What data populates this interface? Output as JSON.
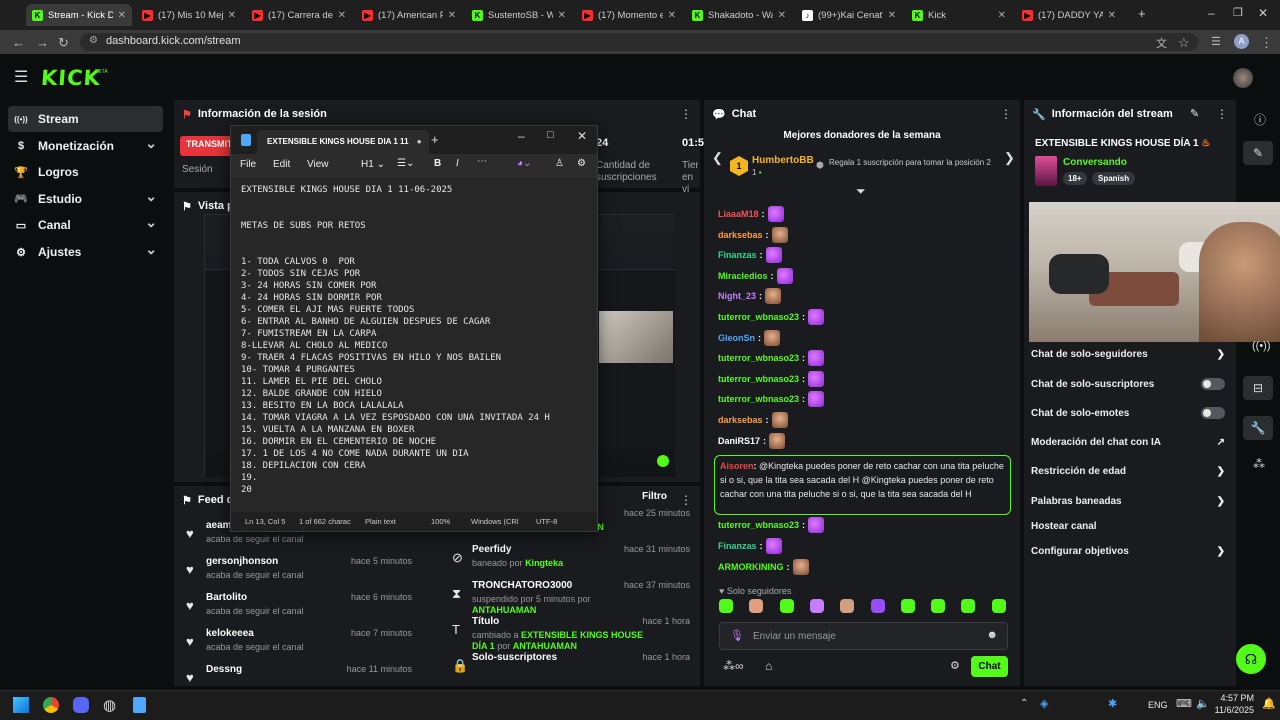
{
  "browser": {
    "tabs": [
      {
        "label": "Stream - Kick Dash",
        "favicon": "kick",
        "active": true
      },
      {
        "label": "(17) Mis 10 Mejore",
        "favicon": "youtube"
      },
      {
        "label": "(17) Carrera de gu",
        "favicon": "youtube"
      },
      {
        "label": "(17) American Pie",
        "favicon": "youtube"
      },
      {
        "label": "SustentoSB - Watc",
        "favicon": "kick"
      },
      {
        "label": "(17) Momento exa",
        "favicon": "youtube"
      },
      {
        "label": "Shakadoto - Watc",
        "favicon": "kick"
      },
      {
        "label": "(99+)Kai Cenat's l",
        "favicon": "tiktok"
      },
      {
        "label": "Kick",
        "favicon": "kick"
      },
      {
        "label": "(17) DADDY YANK",
        "favicon": "youtube"
      }
    ],
    "url": "dashboard.kick.com/stream",
    "profile_initial": "A"
  },
  "header": {
    "logo": "KICK",
    "beta": "BETA"
  },
  "sidebar": {
    "items": [
      {
        "label": "Stream",
        "icon": "broadcast-icon",
        "selected": true
      },
      {
        "label": "Monetización",
        "icon": "dollar-icon",
        "chevron": true
      },
      {
        "label": "Logros",
        "icon": "trophy-icon"
      },
      {
        "label": "Estudio",
        "icon": "gamepad-icon",
        "chevron": true
      },
      {
        "label": "Canal",
        "icon": "monitor-icon",
        "chevron": true
      },
      {
        "label": "Ajustes",
        "icon": "gear-icon",
        "chevron": true
      }
    ]
  },
  "session": {
    "title": "Información de la sesión",
    "live_badge": "TRANSMIT",
    "session_label": "Sesión",
    "stat_24": "24",
    "stat_24_label": "Cantidad de suscripciones",
    "stat_time": "01:5",
    "stat_time_label": "Tiem en vi"
  },
  "preview": {
    "title": "Vista pr"
  },
  "feed": {
    "title": "Feed de",
    "filter": "Filtro",
    "left": [
      {
        "name": "aeam",
        "desc": "acaba de seguir el canal",
        "time": ""
      },
      {
        "name": "gersonjhonson",
        "desc": "acaba de seguir el canal",
        "time": "hace 5 minutos"
      },
      {
        "name": "Bartolito",
        "desc": "acaba de seguir el canal",
        "time": "hace 6 minutos"
      },
      {
        "name": "kelokeeea",
        "desc": "acaba de seguir el canal",
        "time": "hace 7 minutos"
      },
      {
        "name": "Dessng",
        "desc": "",
        "time": "hace 11 minutos"
      }
    ],
    "right": [
      {
        "name": "",
        "desc": "desbaneado por",
        "by": "ANTAHUAMAN",
        "time": "hace 25 minutos"
      },
      {
        "name": "Peerfidy",
        "desc": "baneado por",
        "by": "Kingteka",
        "time": "hace 31 minutos"
      },
      {
        "name": "TRONCHATORO3000",
        "desc": "suspendido por 5 minutos por",
        "by": "ANTAHUAMAN",
        "time": "hace 37 minutos"
      },
      {
        "name": "Título",
        "desc": "cambiado a",
        "by": "EXTENSIBLE KINGS HOUSE DÍA 1",
        "by2": "por",
        "by3": "ANTAHUAMAN",
        "time": "hace 1 hora"
      },
      {
        "name": "Solo-suscriptores",
        "desc": "",
        "time": "hace 1 hora"
      }
    ]
  },
  "notepad": {
    "tab_title": "EXTENSIBLE KINGS HOUSE DIA 1 11",
    "menu": [
      "File",
      "Edit",
      "View"
    ],
    "heading": "H1",
    "content": "EXTENSIBLE KINGS HOUSE DIA 1 11-06-2025\n\n\nMETAS DE SUBS POR RETOS\n\n\n1- TODA CALVOS 0  POR\n2- TODOS SIN CEJAS POR\n3- 24 HORAS SIN COMER POR\n4- 24 HORAS SIN DORMIR POR\n5- COMER EL AJI MAS FUERTE TODOS\n6- ENTRAR AL BANHO DE ALGUIEN DESPUES DE CAGAR\n7- FUMISTREAM EN LA CARPA\n8-LLEVAR AL CHOLO AL MEDICO\n9- TRAER 4 FLACAS POSITIVAS EN HILO Y NOS BAILEN\n10- TOMAR 4 PURGANTES\n11. LAMER EL PIE DEL CHOLO\n12. BALDE GRANDE CON HIELO\n13. BESITO EN LA BOCA LALALALA\n14. TOMAR VIAGRA A LA VEZ ESPOSDADO CON UNA INVITADA 24 H\n15. VUELTA A LA MANZANA EN BOXER\n16. DORMIR EN EL CEMENTERIO DE NOCHE\n17. 1 DE LOS 4 NO COME NADA DURANTE UN DIA\n18. DEPILACION CON CERA\n19.\n20",
    "status": {
      "pos": "Ln 13, Col 5",
      "chars": "1 of 662 charac",
      "type": "Plain text",
      "zoom": "100%",
      "eol": "Windows (CRl",
      "enc": "UTF-8"
    }
  },
  "chat": {
    "title": "Chat",
    "donors_title": "Mejores donadores de la semana",
    "top_donor": "HumbertoBB",
    "top_donor_rank": "1",
    "top_donor_count": "1",
    "second_text": "Regala 1 suscripción para tomar la posición 2",
    "messages": [
      {
        "user": "LiaaaM18",
        "color": "#ff4f4f",
        "emote": "purple"
      },
      {
        "user": "darksebas",
        "color": "#ff9f3a",
        "emote": "face"
      },
      {
        "user": "Finanzas",
        "color": "#2fd68e",
        "emote": "purple"
      },
      {
        "user": "Miracledios",
        "color": "#53fc18",
        "emote": "purple"
      },
      {
        "user": "Night_23",
        "color": "#c77dff",
        "emote": "face"
      },
      {
        "user": "tuterror_wbnaso23",
        "color": "#53fc18",
        "emote": "purple"
      },
      {
        "user": "GleonSn",
        "color": "#4ea8ff",
        "emote": "face"
      },
      {
        "user": "tuterror_wbnaso23",
        "color": "#53fc18",
        "emote": "purple"
      },
      {
        "user": "tuterror_wbnaso23",
        "color": "#53fc18",
        "emote": "purple"
      },
      {
        "user": "tuterror_wbnaso23",
        "color": "#53fc18",
        "emote": "purple"
      },
      {
        "user": "darksebas",
        "color": "#ff9f3a",
        "emote": "face"
      },
      {
        "user": "DaniRS17",
        "color": "#ffffff",
        "emote": "face"
      }
    ],
    "highlight": {
      "user": "Aisoren",
      "text": "@Kingteka puedes poner de reto cachar con una tita peluche si o si, que la tita sea sacada del H  @Kingteka puedes poner de reto cachar con una tita peluche si o si, que la tita sea sacada del H"
    },
    "after": [
      {
        "user": "tuterror_wbnaso23",
        "color": "#53fc18",
        "emote": "purple"
      },
      {
        "user": "Finanzas",
        "color": "#2fd68e",
        "emote": "purple"
      },
      {
        "user": "ARMORKINING",
        "color": "#53fc18",
        "emote": "face"
      }
    ],
    "followers_only": "Solo seguidores",
    "input_placeholder": "Enviar un mensaje",
    "send": "Chat"
  },
  "info": {
    "title": "Información del stream",
    "stream_title": "EXTENSIBLE KINGS HOUSE DÍA 1",
    "category": "Conversando",
    "badge_age": "18+",
    "badge_lang": "Spanish",
    "rows": [
      {
        "label": "Chat de solo-seguidores",
        "control": "chevron"
      },
      {
        "label": "Chat de solo-suscriptores",
        "control": "toggle"
      },
      {
        "label": "Chat de solo-emotes",
        "control": "toggle"
      },
      {
        "label": "Moderación del chat con IA",
        "control": "external"
      },
      {
        "label": "Restricción de edad",
        "control": "chevron"
      },
      {
        "label": "Palabras baneadas",
        "control": "chevron"
      },
      {
        "label": "Hostear canal",
        "control": "none"
      },
      {
        "label": "Configurar objetivos",
        "control": "chevron"
      }
    ]
  },
  "taskbar": {
    "lang": "ENG",
    "time": "4:57 PM",
    "date": "11/6/2025"
  },
  "colors": {
    "kick_green": "#53fc18",
    "panel": "#191b1f",
    "bg": "#0b0e0f"
  }
}
